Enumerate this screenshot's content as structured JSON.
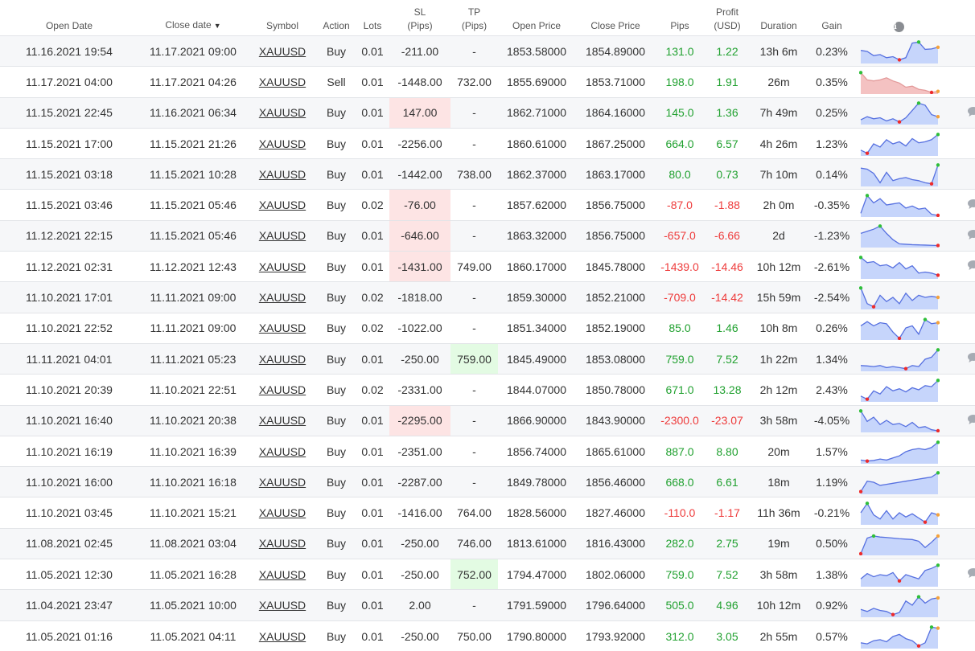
{
  "columns": {
    "open_date": "Open Date",
    "close_date": "Close date",
    "sort_indicator": "▼",
    "symbol": "Symbol",
    "action": "Action",
    "lots": "Lots",
    "sl_line1": "SL",
    "sl_line2": "(Pips)",
    "tp_line1": "TP",
    "tp_line2": "(Pips)",
    "open_price": "Open Price",
    "close_price": "Close Price",
    "pips": "Pips",
    "profit_line1": "Profit",
    "profit_line2": "(USD)",
    "duration": "Duration",
    "gain": "Gain",
    "info_icon": "info-icon"
  },
  "colors": {
    "positive": "#21a130",
    "negative": "#ee3b3b",
    "sl_hit_bg": "#fde4e4",
    "tp_hit_bg": "#e3fbe3",
    "spark_fill": "#c6d5fb",
    "spark_line": "#5670e0",
    "spark_fill_neg": "#f4c2c2",
    "spark_line_neg": "#e39a9a",
    "marker_high": "#2fbf3a",
    "marker_low": "#ee2b2b",
    "marker_end": "#f5a23b",
    "comment_icon": "#a6abb3"
  },
  "trades": [
    {
      "open": "11.16.2021 19:54",
      "close": "11.17.2021 09:00",
      "symbol": "XAUUSD",
      "action": "Buy",
      "lots": "0.01",
      "sl": "-211.00",
      "tp": "-",
      "open_price": "1853.58000",
      "close_price": "1854.89000",
      "pips": "131.0",
      "profit": "1.22",
      "duration": "13h 6m",
      "gain": "0.23%",
      "positive": true,
      "sl_hit": false,
      "tp_hit": false,
      "comment": false,
      "spark": [
        0.55,
        0.5,
        0.3,
        0.35,
        0.2,
        0.25,
        0.1,
        0.2,
        0.9,
        0.95,
        0.6,
        0.62,
        0.7
      ],
      "spark_neg": false
    },
    {
      "open": "11.17.2021 04:00",
      "close": "11.17.2021 04:26",
      "symbol": "XAUUSD",
      "action": "Sell",
      "lots": "0.01",
      "sl": "-1448.00",
      "tp": "732.00",
      "open_price": "1855.69000",
      "close_price": "1853.71000",
      "pips": "198.0",
      "profit": "1.91",
      "duration": "26m",
      "gain": "0.35%",
      "positive": true,
      "sl_hit": false,
      "tp_hit": false,
      "comment": false,
      "spark": [
        0.95,
        0.6,
        0.55,
        0.6,
        0.7,
        0.55,
        0.45,
        0.25,
        0.3,
        0.15,
        0.1,
        0.0,
        0.05
      ],
      "spark_neg": true
    },
    {
      "open": "11.15.2021 22:45",
      "close": "11.16.2021 06:34",
      "symbol": "XAUUSD",
      "action": "Buy",
      "lots": "0.01",
      "sl": "147.00",
      "tp": "-",
      "open_price": "1862.71000",
      "close_price": "1864.16000",
      "pips": "145.0",
      "profit": "1.36",
      "duration": "7h 49m",
      "gain": "0.25%",
      "positive": true,
      "sl_hit": true,
      "tp_hit": false,
      "comment": true,
      "spark": [
        0.15,
        0.3,
        0.2,
        0.25,
        0.1,
        0.2,
        0.05,
        0.25,
        0.6,
        0.95,
        0.85,
        0.4,
        0.3
      ],
      "spark_neg": false
    },
    {
      "open": "11.15.2021 17:00",
      "close": "11.15.2021 21:26",
      "symbol": "XAUUSD",
      "action": "Buy",
      "lots": "0.01",
      "sl": "-2256.00",
      "tp": "-",
      "open_price": "1860.61000",
      "close_price": "1867.25000",
      "pips": "664.0",
      "profit": "6.57",
      "duration": "4h 26m",
      "gain": "1.23%",
      "positive": true,
      "sl_hit": false,
      "tp_hit": false,
      "comment": false,
      "spark": [
        0.2,
        0.05,
        0.5,
        0.35,
        0.7,
        0.5,
        0.6,
        0.4,
        0.75,
        0.55,
        0.6,
        0.7,
        0.95
      ],
      "spark_neg": false
    },
    {
      "open": "11.15.2021 03:18",
      "close": "11.15.2021 10:28",
      "symbol": "XAUUSD",
      "action": "Buy",
      "lots": "0.01",
      "sl": "-1442.00",
      "tp": "738.00",
      "open_price": "1862.37000",
      "close_price": "1863.17000",
      "pips": "80.0",
      "profit": "0.73",
      "duration": "7h 10m",
      "gain": "0.14%",
      "positive": true,
      "sl_hit": false,
      "tp_hit": false,
      "comment": false,
      "spark": [
        0.8,
        0.75,
        0.55,
        0.1,
        0.6,
        0.2,
        0.3,
        0.35,
        0.25,
        0.2,
        0.1,
        0.05,
        0.95
      ],
      "spark_neg": false
    },
    {
      "open": "11.15.2021 03:46",
      "close": "11.15.2021 05:46",
      "symbol": "XAUUSD",
      "action": "Buy",
      "lots": "0.02",
      "sl": "-76.00",
      "tp": "-",
      "open_price": "1857.62000",
      "close_price": "1856.75000",
      "pips": "-87.0",
      "profit": "-1.88",
      "duration": "2h 0m",
      "gain": "-0.35%",
      "positive": false,
      "sl_hit": true,
      "tp_hit": false,
      "comment": true,
      "spark": [
        0.1,
        0.95,
        0.6,
        0.8,
        0.5,
        0.55,
        0.6,
        0.35,
        0.45,
        0.3,
        0.35,
        0.05,
        0.0
      ],
      "spark_neg": false
    },
    {
      "open": "11.12.2021 22:15",
      "close": "11.15.2021 05:46",
      "symbol": "XAUUSD",
      "action": "Buy",
      "lots": "0.01",
      "sl": "-646.00",
      "tp": "-",
      "open_price": "1863.32000",
      "close_price": "1856.75000",
      "pips": "-657.0",
      "profit": "-6.66",
      "duration": "2d",
      "gain": "-1.23%",
      "positive": false,
      "sl_hit": true,
      "tp_hit": false,
      "comment": true,
      "spark": [
        0.6,
        0.7,
        0.8,
        0.95,
        0.6,
        0.3,
        0.1,
        0.08,
        0.06,
        0.05,
        0.04,
        0.03,
        0.02
      ],
      "spark_neg": false
    },
    {
      "open": "11.12.2021 02:31",
      "close": "11.12.2021 12:43",
      "symbol": "XAUUSD",
      "action": "Buy",
      "lots": "0.01",
      "sl": "-1431.00",
      "tp": "749.00",
      "open_price": "1860.17000",
      "close_price": "1845.78000",
      "pips": "-1439.0",
      "profit": "-14.46",
      "duration": "10h 12m",
      "gain": "-2.61%",
      "positive": false,
      "sl_hit": true,
      "tp_hit": false,
      "comment": true,
      "spark": [
        0.95,
        0.7,
        0.75,
        0.55,
        0.6,
        0.45,
        0.7,
        0.4,
        0.55,
        0.2,
        0.25,
        0.2,
        0.1
      ],
      "spark_neg": false
    },
    {
      "open": "11.10.2021 17:01",
      "close": "11.11.2021 09:00",
      "symbol": "XAUUSD",
      "action": "Buy",
      "lots": "0.02",
      "sl": "-1818.00",
      "tp": "-",
      "open_price": "1859.30000",
      "close_price": "1852.21000",
      "pips": "-709.0",
      "profit": "-14.42",
      "duration": "15h 59m",
      "gain": "-2.54%",
      "positive": false,
      "sl_hit": false,
      "tp_hit": false,
      "comment": false,
      "spark": [
        0.95,
        0.2,
        0.05,
        0.6,
        0.3,
        0.5,
        0.2,
        0.7,
        0.35,
        0.6,
        0.5,
        0.55,
        0.5
      ],
      "spark_neg": false
    },
    {
      "open": "11.10.2021 22:52",
      "close": "11.11.2021 09:00",
      "symbol": "XAUUSD",
      "action": "Buy",
      "lots": "0.02",
      "sl": "-1022.00",
      "tp": "-",
      "open_price": "1851.34000",
      "close_price": "1852.19000",
      "pips": "85.0",
      "profit": "1.46",
      "duration": "10h 8m",
      "gain": "0.26%",
      "positive": true,
      "sl_hit": false,
      "tp_hit": false,
      "comment": false,
      "spark": [
        0.6,
        0.8,
        0.6,
        0.75,
        0.7,
        0.3,
        0.0,
        0.5,
        0.6,
        0.2,
        0.9,
        0.7,
        0.75
      ],
      "spark_neg": false
    },
    {
      "open": "11.11.2021 04:01",
      "close": "11.11.2021 05:23",
      "symbol": "XAUUSD",
      "action": "Buy",
      "lots": "0.01",
      "sl": "-250.00",
      "tp": "759.00",
      "open_price": "1845.49000",
      "close_price": "1853.08000",
      "pips": "759.0",
      "profit": "7.52",
      "duration": "1h 22m",
      "gain": "1.34%",
      "positive": true,
      "sl_hit": false,
      "tp_hit": true,
      "comment": true,
      "spark": [
        0.2,
        0.18,
        0.15,
        0.2,
        0.1,
        0.15,
        0.1,
        0.05,
        0.2,
        0.15,
        0.5,
        0.6,
        0.95
      ],
      "spark_neg": false
    },
    {
      "open": "11.10.2021 20:39",
      "close": "11.10.2021 22:51",
      "symbol": "XAUUSD",
      "action": "Buy",
      "lots": "0.02",
      "sl": "-2331.00",
      "tp": "-",
      "open_price": "1844.07000",
      "close_price": "1850.78000",
      "pips": "671.0",
      "profit": "13.28",
      "duration": "2h 12m",
      "gain": "2.43%",
      "positive": true,
      "sl_hit": false,
      "tp_hit": false,
      "comment": false,
      "spark": [
        0.2,
        0.05,
        0.45,
        0.3,
        0.65,
        0.45,
        0.55,
        0.4,
        0.6,
        0.5,
        0.7,
        0.65,
        0.95
      ],
      "spark_neg": false
    },
    {
      "open": "11.10.2021 16:40",
      "close": "11.10.2021 20:38",
      "symbol": "XAUUSD",
      "action": "Buy",
      "lots": "0.01",
      "sl": "-2295.00",
      "tp": "-",
      "open_price": "1866.90000",
      "close_price": "1843.90000",
      "pips": "-2300.0",
      "profit": "-23.07",
      "duration": "3h 58m",
      "gain": "-4.05%",
      "positive": false,
      "sl_hit": true,
      "tp_hit": false,
      "comment": true,
      "spark": [
        0.95,
        0.45,
        0.65,
        0.3,
        0.5,
        0.3,
        0.35,
        0.2,
        0.4,
        0.15,
        0.2,
        0.05,
        0.0
      ],
      "spark_neg": false
    },
    {
      "open": "11.10.2021 16:19",
      "close": "11.10.2021 16:39",
      "symbol": "XAUUSD",
      "action": "Buy",
      "lots": "0.01",
      "sl": "-2351.00",
      "tp": "-",
      "open_price": "1856.74000",
      "close_price": "1865.61000",
      "pips": "887.0",
      "profit": "8.80",
      "duration": "20m",
      "gain": "1.57%",
      "positive": true,
      "sl_hit": false,
      "tp_hit": false,
      "comment": false,
      "spark": [
        0.1,
        0.05,
        0.08,
        0.15,
        0.1,
        0.2,
        0.3,
        0.5,
        0.6,
        0.65,
        0.6,
        0.7,
        0.95
      ],
      "spark_neg": false
    },
    {
      "open": "11.10.2021 16:00",
      "close": "11.10.2021 16:18",
      "symbol": "XAUUSD",
      "action": "Buy",
      "lots": "0.01",
      "sl": "-2287.00",
      "tp": "-",
      "open_price": "1849.78000",
      "close_price": "1856.46000",
      "pips": "668.0",
      "profit": "6.61",
      "duration": "18m",
      "gain": "1.19%",
      "positive": true,
      "sl_hit": false,
      "tp_hit": false,
      "comment": false,
      "spark": [
        0.05,
        0.55,
        0.5,
        0.35,
        0.4,
        0.45,
        0.5,
        0.55,
        0.6,
        0.65,
        0.7,
        0.75,
        0.95
      ],
      "spark_neg": false
    },
    {
      "open": "11.10.2021 03:45",
      "close": "11.10.2021 15:21",
      "symbol": "XAUUSD",
      "action": "Buy",
      "lots": "0.01",
      "sl": "-1416.00",
      "tp": "764.00",
      "open_price": "1828.56000",
      "close_price": "1827.46000",
      "pips": "-110.0",
      "profit": "-1.17",
      "duration": "11h 36m",
      "gain": "-0.21%",
      "positive": false,
      "sl_hit": false,
      "tp_hit": false,
      "comment": false,
      "spark": [
        0.5,
        0.95,
        0.4,
        0.2,
        0.6,
        0.2,
        0.5,
        0.3,
        0.45,
        0.25,
        0.05,
        0.5,
        0.4
      ],
      "spark_neg": false
    },
    {
      "open": "11.08.2021 02:45",
      "close": "11.08.2021 03:04",
      "symbol": "XAUUSD",
      "action": "Buy",
      "lots": "0.01",
      "sl": "-250.00",
      "tp": "746.00",
      "open_price": "1813.61000",
      "close_price": "1816.43000",
      "pips": "282.0",
      "profit": "2.75",
      "duration": "19m",
      "gain": "0.50%",
      "positive": true,
      "sl_hit": false,
      "tp_hit": false,
      "comment": false,
      "spark": [
        0.0,
        0.75,
        0.85,
        0.8,
        0.78,
        0.75,
        0.72,
        0.7,
        0.68,
        0.6,
        0.3,
        0.55,
        0.85
      ],
      "spark_neg": false
    },
    {
      "open": "11.05.2021 12:30",
      "close": "11.05.2021 16:28",
      "symbol": "XAUUSD",
      "action": "Buy",
      "lots": "0.01",
      "sl": "-250.00",
      "tp": "752.00",
      "open_price": "1794.47000",
      "close_price": "1802.06000",
      "pips": "759.0",
      "profit": "7.52",
      "duration": "3h 58m",
      "gain": "1.38%",
      "positive": true,
      "sl_hit": false,
      "tp_hit": true,
      "comment": true,
      "spark": [
        0.3,
        0.55,
        0.4,
        0.5,
        0.45,
        0.6,
        0.2,
        0.5,
        0.4,
        0.3,
        0.7,
        0.8,
        0.95
      ],
      "spark_neg": false
    },
    {
      "open": "11.04.2021 23:47",
      "close": "11.05.2021 10:00",
      "symbol": "XAUUSD",
      "action": "Buy",
      "lots": "0.01",
      "sl": "2.00",
      "tp": "-",
      "open_price": "1791.59000",
      "close_price": "1796.64000",
      "pips": "505.0",
      "profit": "4.96",
      "duration": "10h 12m",
      "gain": "0.92%",
      "positive": true,
      "sl_hit": false,
      "tp_hit": false,
      "comment": false,
      "spark": [
        0.3,
        0.2,
        0.35,
        0.25,
        0.2,
        0.05,
        0.15,
        0.7,
        0.5,
        0.9,
        0.6,
        0.8,
        0.85
      ],
      "spark_neg": false
    },
    {
      "open": "11.05.2021 01:16",
      "close": "11.05.2021 04:11",
      "symbol": "XAUUSD",
      "action": "Buy",
      "lots": "0.01",
      "sl": "-250.00",
      "tp": "750.00",
      "open_price": "1790.80000",
      "close_price": "1793.92000",
      "pips": "312.0",
      "profit": "3.05",
      "duration": "2h 55m",
      "gain": "0.57%",
      "positive": true,
      "sl_hit": false,
      "tp_hit": false,
      "comment": false,
      "spark": [
        0.2,
        0.15,
        0.3,
        0.35,
        0.25,
        0.5,
        0.6,
        0.4,
        0.3,
        0.05,
        0.2,
        0.95,
        0.9
      ],
      "spark_neg": false
    }
  ]
}
